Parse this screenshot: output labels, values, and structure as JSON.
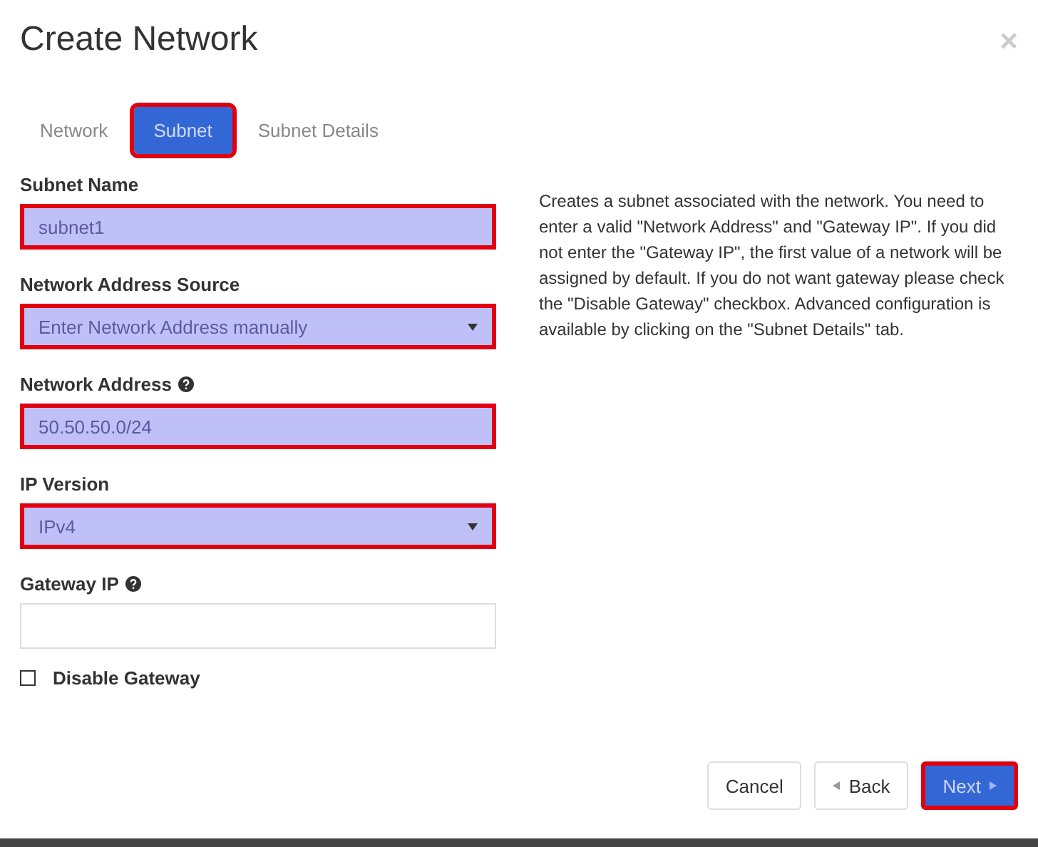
{
  "dialog": {
    "title": "Create Network",
    "close": "×"
  },
  "tabs": [
    {
      "label": "Network",
      "selected": false,
      "highlighted": false
    },
    {
      "label": "Subnet",
      "selected": true,
      "highlighted": true
    },
    {
      "label": "Subnet Details",
      "selected": false,
      "highlighted": false
    }
  ],
  "fields": [
    {
      "kind": "text",
      "label": "Subnet Name",
      "help": false,
      "value": "subnet1",
      "highlighted": true
    },
    {
      "kind": "select",
      "label": "Network Address Source",
      "help": false,
      "value": "Enter Network Address manually",
      "highlighted": true
    },
    {
      "kind": "text",
      "label": "Network Address",
      "help": true,
      "value": "50.50.50.0/24",
      "highlighted": true
    },
    {
      "kind": "select",
      "label": "IP Version",
      "help": false,
      "value": "IPv4",
      "highlighted": true
    },
    {
      "kind": "text",
      "label": "Gateway IP",
      "help": true,
      "highlighted": false
    }
  ],
  "checkbox": {
    "label": "Disable Gateway",
    "checked": false
  },
  "description": "Creates a subnet associated with the network. You need to enter a valid \"Network Address\" and \"Gateway IP\". If you did not enter the \"Gateway IP\", the first value of a network will be assigned by default. If you do not want gateway please check the \"Disable Gateway\" checkbox. Advanced configuration is available by clicking on the \"Subnet Details\" tab.",
  "buttons": [
    {
      "kind": "default",
      "label": "Cancel",
      "highlighted": false
    },
    {
      "kind": "back",
      "label": "Back",
      "highlighted": false
    },
    {
      "kind": "primary",
      "label": "Next",
      "highlighted": true
    }
  ]
}
